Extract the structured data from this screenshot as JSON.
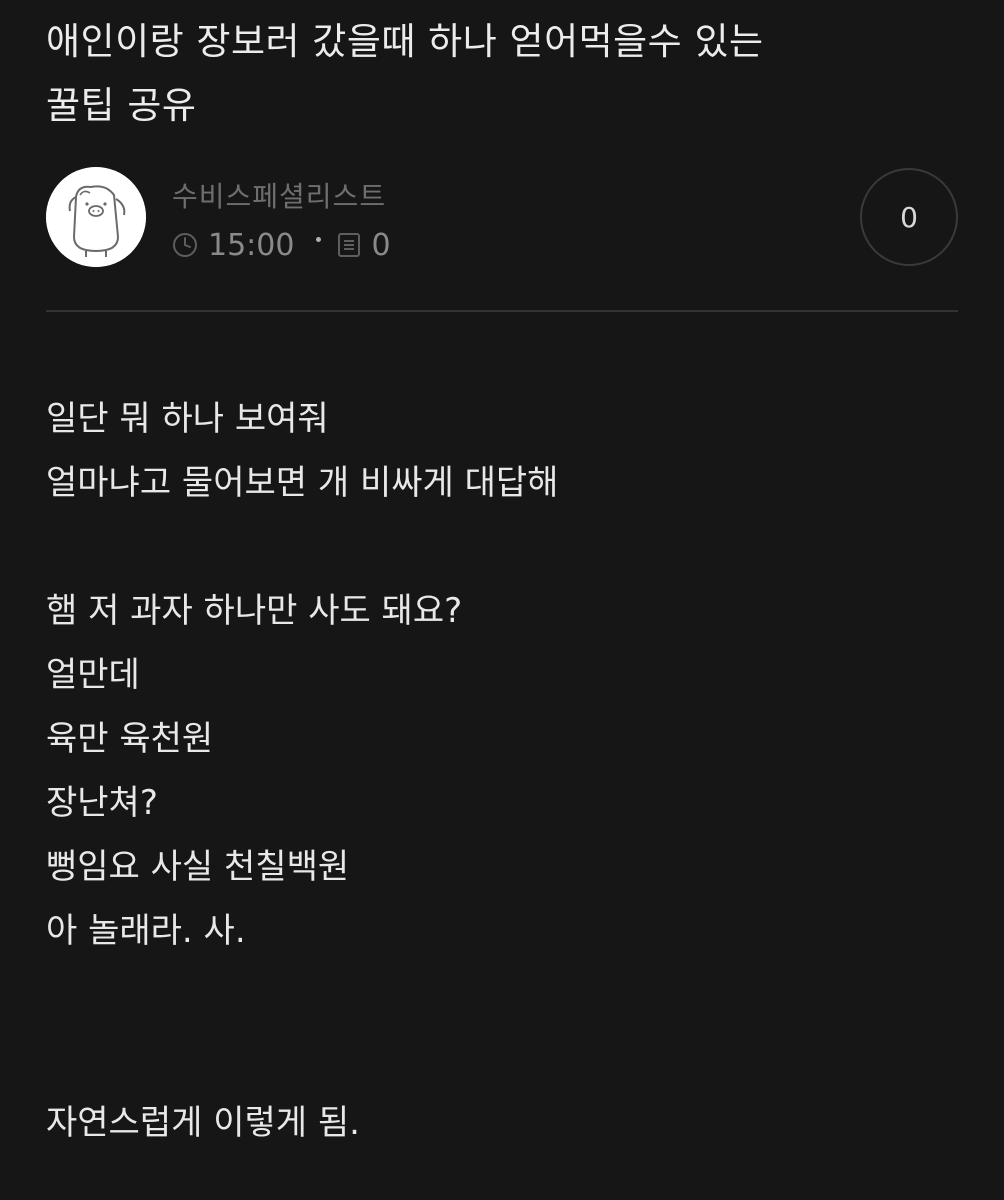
{
  "post": {
    "title_line1": "애인이랑 장보러 갔을때 하나 얻어먹을수 있는",
    "title_line2": "꿀팁 공유"
  },
  "author": {
    "name": "수비스페셜리스트",
    "time": "15:00",
    "comment_count": "0",
    "avatar_icon": "pig-character-avatar"
  },
  "like": {
    "count": "0"
  },
  "content": {
    "lines": [
      "일단 뭐 하나 보여줘",
      "얼마냐고 물어보면 개 비싸게 대답해",
      "햄 저 과자 하나만 사도 돼요?",
      "얼만데",
      "육만 육천원",
      "장난쳐?",
      "뻥임요 사실 천칠백원",
      "아 놀래라. 사.",
      "자연스럽게 이렇게 됨."
    ]
  },
  "colors": {
    "background": "#161616",
    "text": "#e8e8e8",
    "meta": "#8a8a8a",
    "divider": "#333333"
  }
}
